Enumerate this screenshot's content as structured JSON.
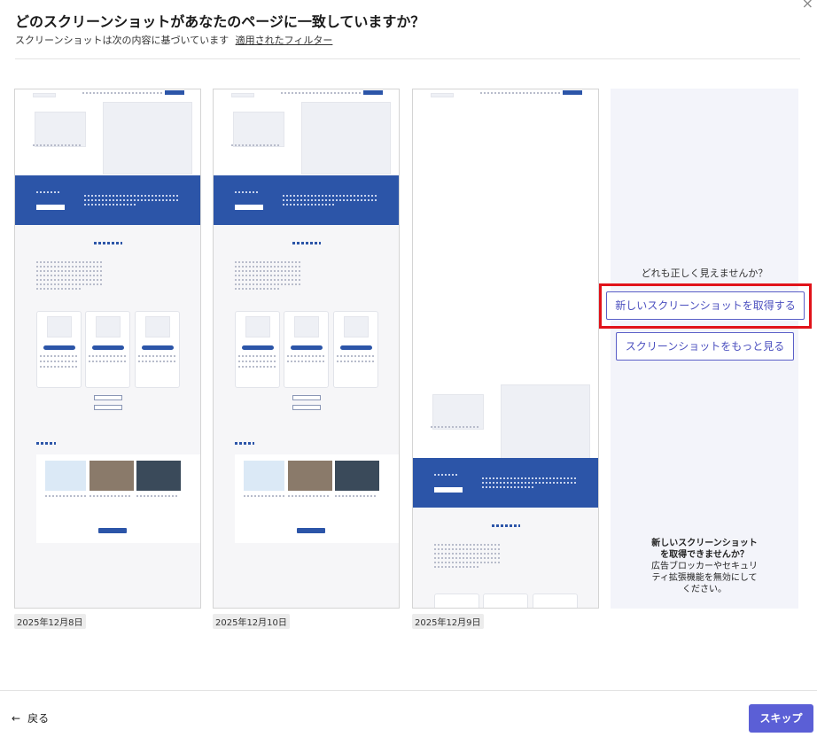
{
  "header": {
    "title": "どのスクリーンショットがあなたのページに一致していますか？",
    "subtitle": "スクリーンショットは次の内容に基づいています",
    "filter_link": "適用されたフィルター",
    "close_glyph": "×"
  },
  "screenshots": [
    {
      "date": "2025年12月8日"
    },
    {
      "date": "2025年12月10日"
    },
    {
      "date": "2025年12月9日"
    }
  ],
  "side": {
    "question": "どれも正しく見えませんか？",
    "new_button": "新しいスクリーンショットを取得する",
    "more_button": "スクリーンショットをもっと見る",
    "note_bold_1": "新しいスクリーンショット",
    "note_bold_2": "を取得できませんか？",
    "note_1": "広告ブロッカーやセキュリ",
    "note_2": "ティ拡張機能を無効にして",
    "note_3": "ください。"
  },
  "footer": {
    "back_label": "戻る",
    "back_arrow": "←",
    "skip_label": "スキップ"
  },
  "colors": {
    "accent": "#5b5fd6",
    "highlight": "#e1131a",
    "page_blue": "#2c55a8"
  }
}
